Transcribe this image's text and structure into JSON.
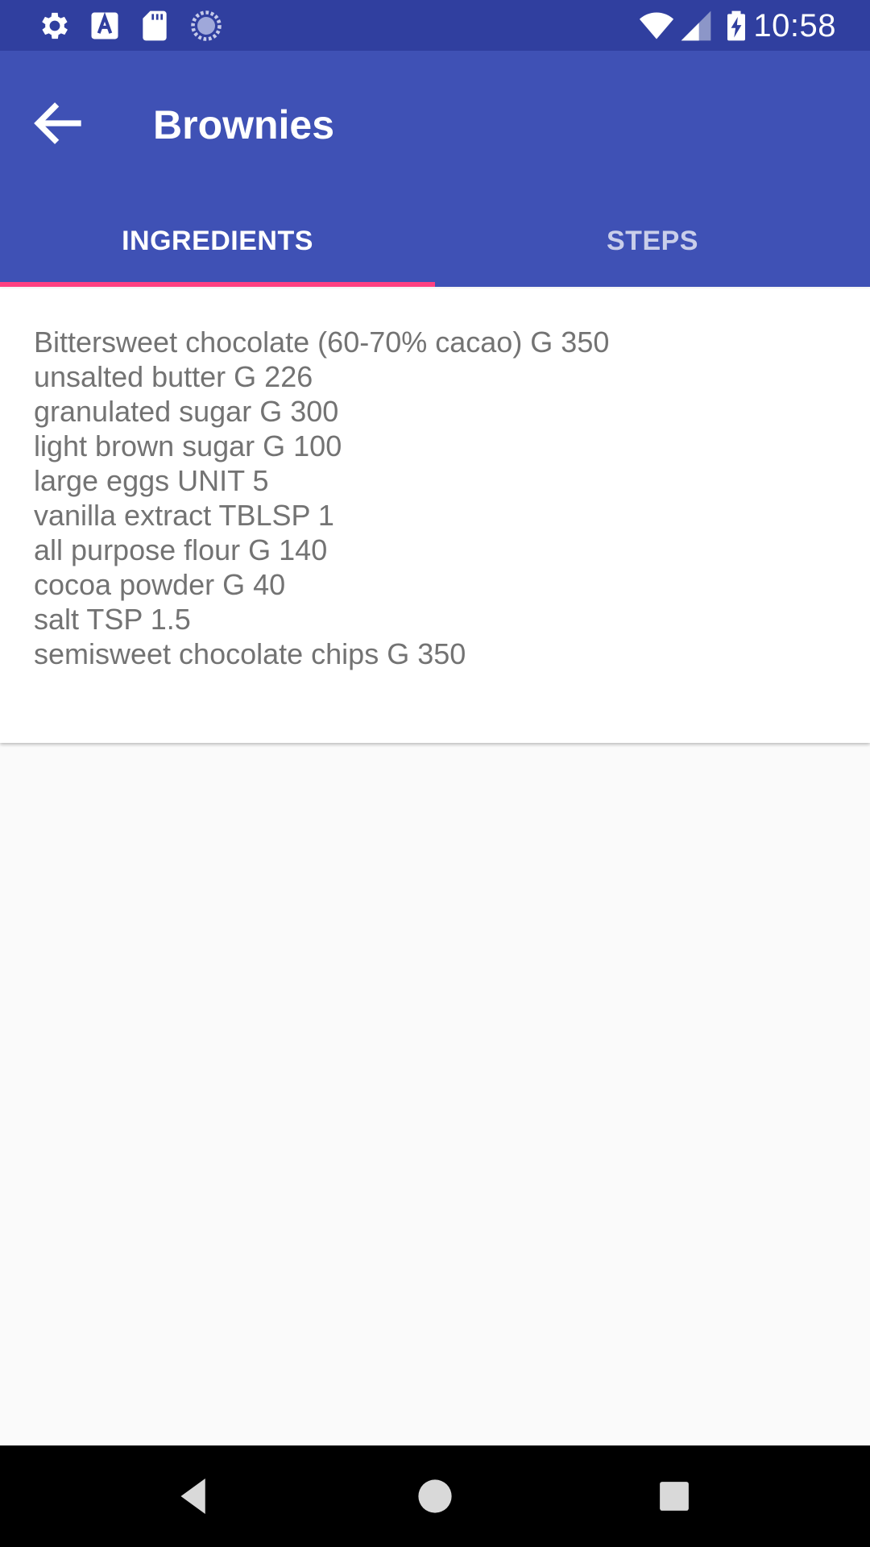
{
  "status_bar": {
    "time": "10:58",
    "left_icons": [
      "settings-icon",
      "font-a-icon",
      "sd-card-icon",
      "sync-icon"
    ],
    "right_icons": [
      "wifi-icon",
      "cell-signal-icon",
      "battery-charging-icon"
    ]
  },
  "app_bar": {
    "title": "Brownies",
    "back_icon": "arrow-left-icon",
    "background": "#3f51b5",
    "status_background": "#303f9f"
  },
  "tabs": [
    {
      "label": "INGREDIENTS",
      "selected": true
    },
    {
      "label": "STEPS",
      "selected": false
    }
  ],
  "tab_indicator_color": "#ff4081",
  "ingredients": [
    "Bittersweet chocolate (60-70% cacao) G 350",
    "unsalted butter G 226",
    "granulated sugar G 300",
    "light brown sugar G 100",
    "large eggs UNIT 5",
    "vanilla extract TBLSP 1",
    "all purpose flour G 140",
    "cocoa powder G 40",
    "salt TSP 1.5",
    "semisweet chocolate chips G 350"
  ],
  "nav_bar": {
    "buttons": [
      "back-triangle-icon",
      "home-circle-icon",
      "recents-square-icon"
    ]
  }
}
